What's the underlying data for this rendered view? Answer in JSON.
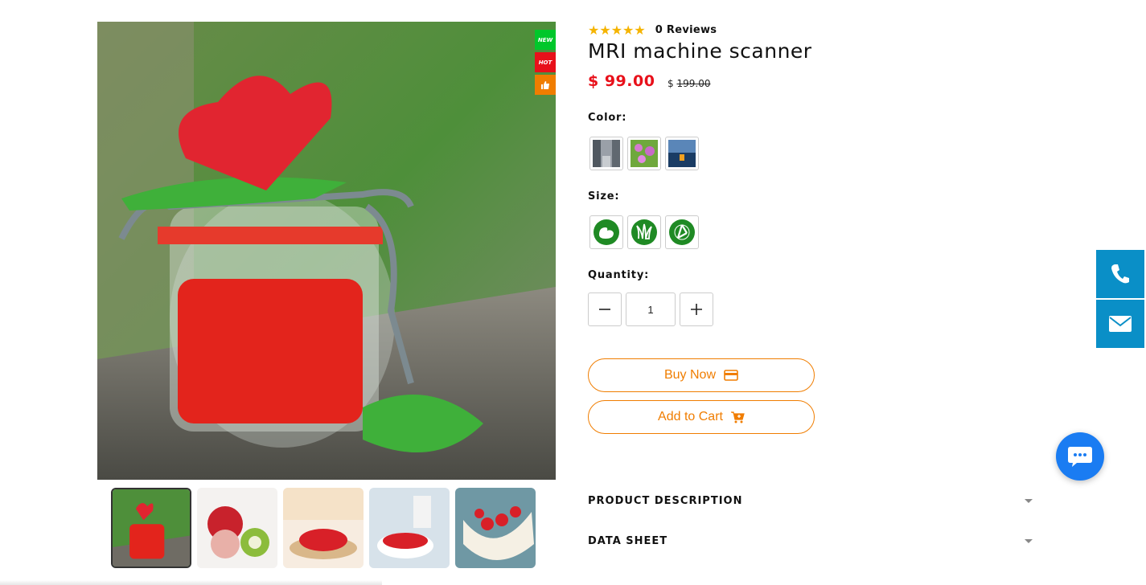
{
  "product": {
    "title": "MRI machine scanner",
    "stars": "★★★★★",
    "reviews": "0 Reviews",
    "price": "$ 99.00",
    "old_price_currency": "$",
    "old_price_amount": "199.00"
  },
  "badges": {
    "new": "NEW",
    "hot": "HOT",
    "like_icon": "thumbs-up-icon"
  },
  "options": {
    "color_label": "Color:",
    "size_label": "Size:",
    "quantity_label": "Quantity:",
    "quantity_value": "1",
    "color_swatches": [
      "street-photo",
      "flower-photo",
      "lake-photo"
    ],
    "size_swatches": [
      "muscle-icon",
      "grass-icon",
      "recycle-icon"
    ]
  },
  "actions": {
    "buy_now": "Buy Now",
    "add_to_cart": "Add to Cart"
  },
  "accordion": {
    "description": "PRODUCT DESCRIPTION",
    "data_sheet": "DATA SHEET"
  },
  "thumbnails": [
    "heart-jar",
    "pomegranate-kiwi",
    "strawberries-plate",
    "strawberries-bowl",
    "strawberries-dish"
  ],
  "colors": {
    "accent": "#f07d00",
    "price": "#e8101a",
    "side": "#0a8fc7",
    "chat": "#1a7cf2"
  }
}
